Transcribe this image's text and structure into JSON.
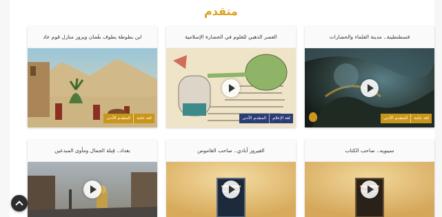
{
  "section": {
    "title": "متقدم"
  },
  "cards": [
    {
      "title": "قسطنطينة.. مدينة العلماء والحضارات",
      "tags": [
        "لغة عامة",
        "المتقدم الأدنى"
      ],
      "tag_color": "#c9961a"
    },
    {
      "title": "العصر الذهبي للعلوم في الحضارة الإسلامية",
      "tags": [
        "لغة الإعلام",
        "المتقدم الأدنى"
      ],
      "tag_color": "#2b3d77"
    },
    {
      "title": "ابن بطوطة يطوف بعُمان ويزور منازل قوم عاد",
      "tags": [
        "لغة عامة",
        "المتقدم الأدنى"
      ],
      "tag_color": "#c9961a"
    },
    {
      "title": "سيبويه.. صاحب الكتاب"
    },
    {
      "title": "الفيروز آبادي.. صاحب القاموس"
    },
    {
      "title": "بغداد.. قِبلة الجمال ومأوى المبدعين"
    }
  ],
  "icons": {
    "play": "play-icon",
    "scroll_top": "chevron-up-icon",
    "channel_logo": "channel-logo-icon"
  }
}
